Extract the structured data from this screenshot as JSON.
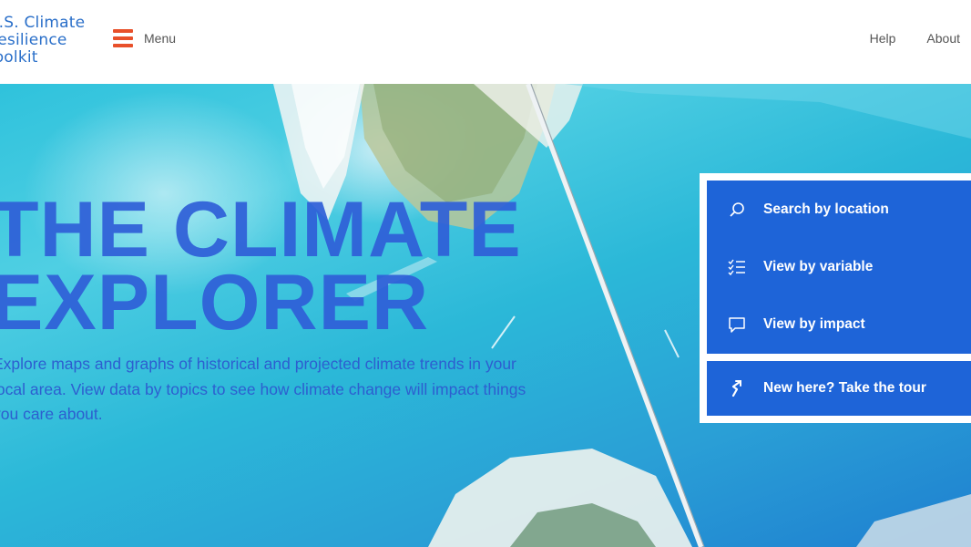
{
  "header": {
    "logo_lines": [
      "U.S. Climate",
      "Resilience",
      "Toolkit"
    ],
    "menu_label": "Menu",
    "links": [
      "Help",
      "About"
    ]
  },
  "hero": {
    "title_lines": [
      "THE CLIMATE",
      "EXPLORER"
    ],
    "description": "Explore maps and graphs of historical and projected climate trends in your local area. View data by topics to see how climate change will impact things you care about."
  },
  "actions": [
    {
      "label": "Search by location",
      "icon": "search-icon"
    },
    {
      "label": "View by variable",
      "icon": "checklist-icon"
    },
    {
      "label": "View by impact",
      "icon": "speech-bubble-icon"
    }
  ],
  "tour": {
    "label": "New here? Take the tour",
    "icon": "tour-arrow-icon"
  },
  "colors": {
    "accent": "#e8502a",
    "brand_blue": "#1e64d8",
    "title_blue": "#2f5fd8",
    "logo_blue": "#2a6fc9"
  }
}
